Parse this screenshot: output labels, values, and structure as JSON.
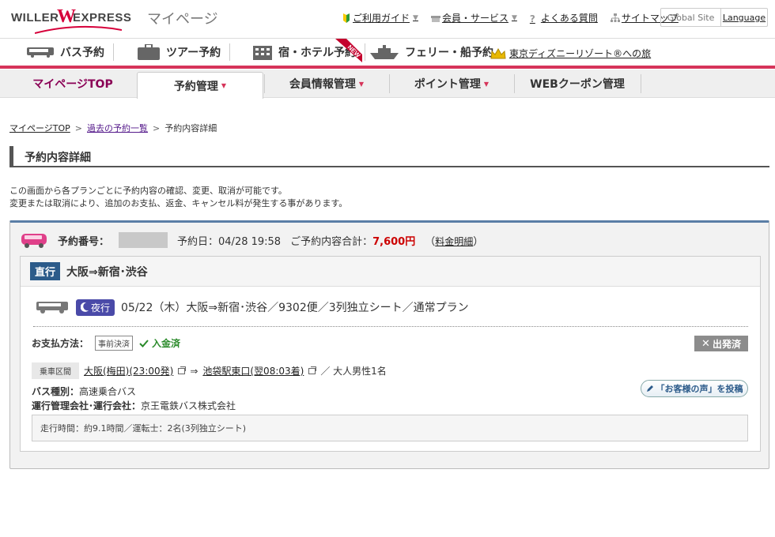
{
  "header": {
    "logo_left": "WILLER",
    "logo_w": "W",
    "logo_right": "EXPRESS",
    "mypage_title": "マイページ",
    "links": [
      {
        "label": "ご利用ガイド",
        "icon": "beginner-mark-icon"
      },
      {
        "label": "会員・サービス",
        "icon": "gift-icon"
      },
      {
        "label": "よくある質問",
        "icon": "question-icon"
      },
      {
        "label": "サイトマップ",
        "icon": "sitemap-icon"
      }
    ],
    "global_site": "Global Site",
    "language": "Language"
  },
  "service_tabs": [
    {
      "label": "バス予約",
      "icon": "bus-icon"
    },
    {
      "label": "ツアー予約",
      "icon": "suitcase-icon"
    },
    {
      "label": "宿・ホテル予約",
      "icon": "hotel-icon",
      "badge": "NEW"
    },
    {
      "label": "フェリー・船予約",
      "icon": "ship-icon"
    }
  ],
  "disney_link": "東京ディズニーリゾート®への旅",
  "subnav": [
    "マイページTOP",
    "予約管理",
    "会員情報管理",
    "ポイント管理",
    "WEBクーポン管理"
  ],
  "breadcrumb": {
    "home": "マイページTOP",
    "history": "過去の予約一覧",
    "current": "予約内容詳細"
  },
  "page_title": "予約内容詳細",
  "intro": [
    "この画面から各プランごとに予約内容の確認、変更、取消が可能です。",
    "変更または取消により、追加のお支払、返金、キャンセル料が発生する事があります。"
  ],
  "reservation": {
    "number_label": "予約番号：",
    "date_text": "予約日：04/28 19:58",
    "total_label": "ご予約内容合計：",
    "total_value": "7,600円",
    "fee_link": "料金明細",
    "fee_link_open": "（",
    "fee_link_close": "）",
    "route_badge": "直行",
    "route_name": "大阪⇒新宿･渋谷",
    "night_badge": "夜行",
    "trip_text": "05/22（木）大阪⇒新宿･渋谷／9302便／3列独立シート／通常プラン",
    "pay_label": "お支払方法：",
    "prepaid": "事前決済",
    "paid": "入金済",
    "departed": "出発済",
    "ride_label": "乗車区間",
    "from_link": "大阪(梅田)(23:00発)",
    "arrow": "⇒",
    "to_link": "池袋駅東口(翌08:03着)",
    "passengers": "／ 大人男性1名",
    "bus_type_label": "バス種別：",
    "bus_type": "高速乗合バス",
    "operator_label": "運行管理会社･運行会社：",
    "operator": "京王電鉄バス株式会社",
    "voice_button": "「お客様の声」を投稿",
    "runtime": "走行時間：約9.1時間／運転士：2名(3列独立シート)"
  },
  "colors": {
    "brand_red": "#d6003a",
    "accent_pink": "#d6345a",
    "route_blue": "#2c5b8a",
    "night_purple": "#4a4aa8",
    "paid_green": "#2a8a2a",
    "total_red": "#cc0000"
  }
}
